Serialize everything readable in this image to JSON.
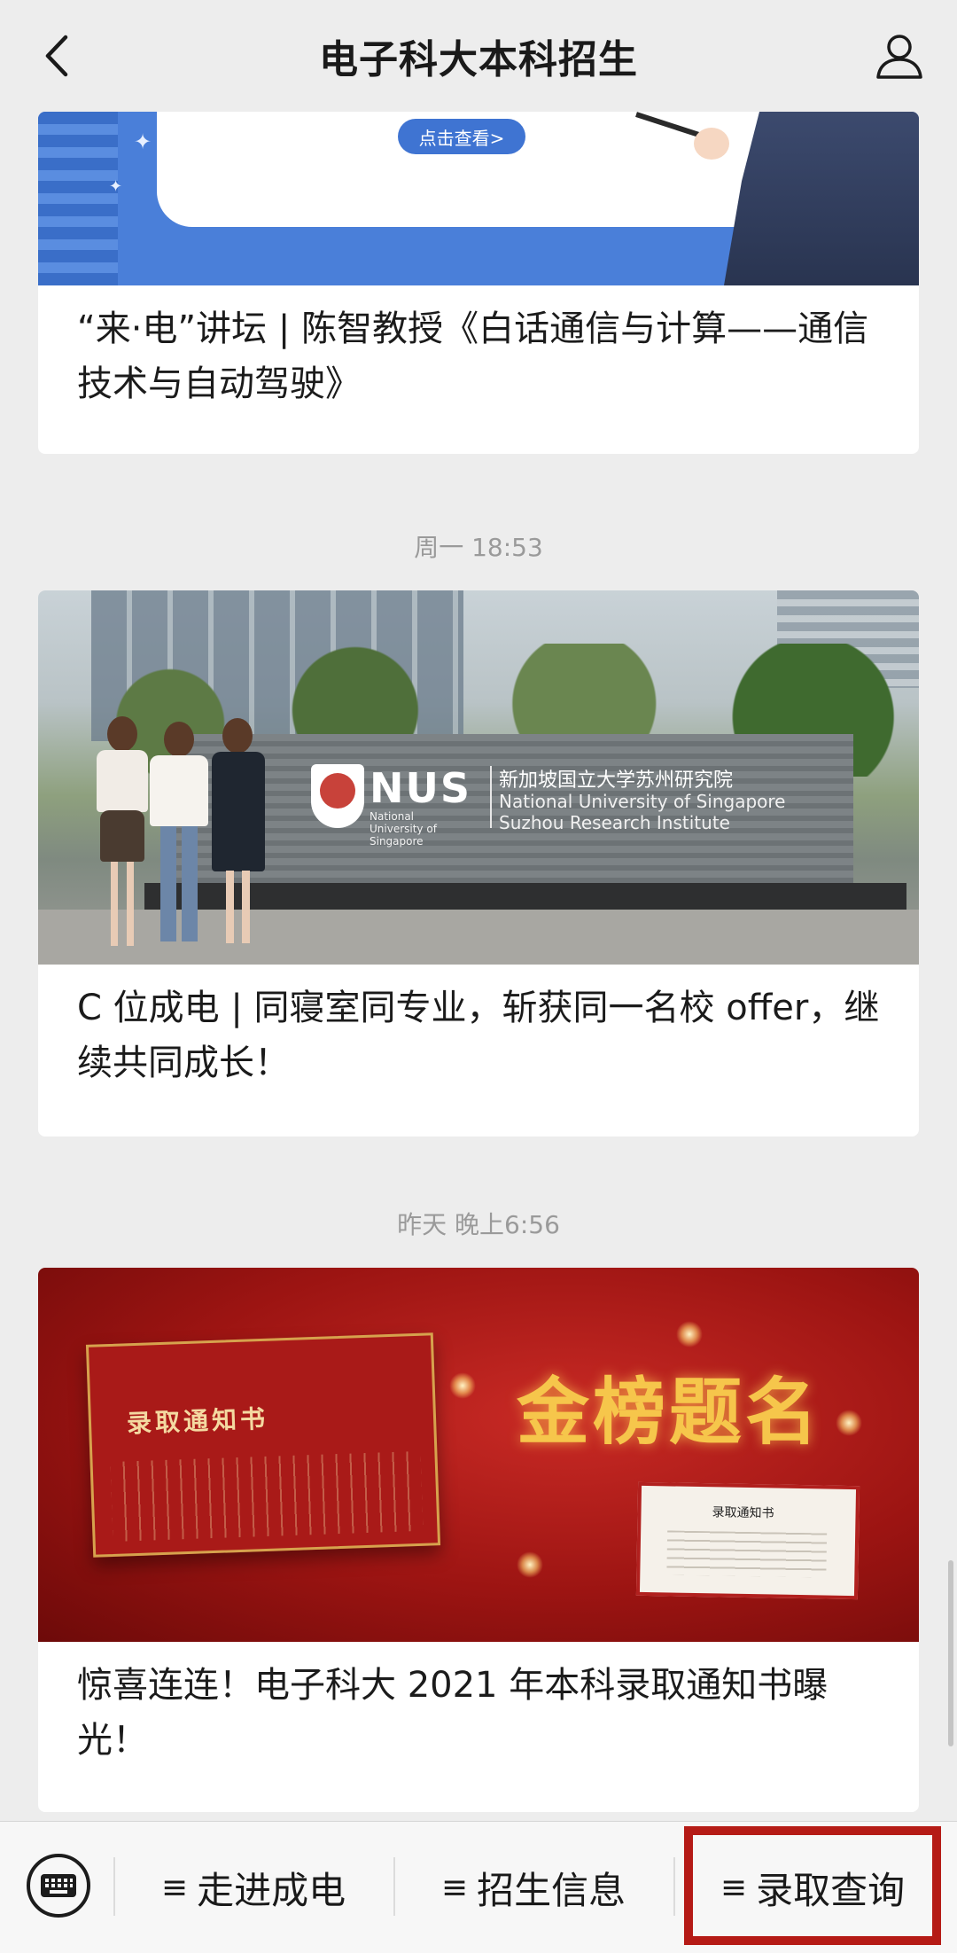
{
  "header": {
    "title": "电子科大本科招生",
    "back_icon": "chevron-left-icon",
    "profile_icon": "person-icon"
  },
  "feed": {
    "items": [
      {
        "time": "",
        "thumb_button": "点击查看>",
        "title": "“来·电”讲坛 | 陈智教授《白话通信与计算——通信技术与自动驾驶》"
      },
      {
        "time": "周一 18:53",
        "thumb_sign": {
          "brand": "NUS",
          "brand_sub": "National University of Singapore",
          "name_cn": "新加坡国立大学苏州研究院",
          "name_en_1": "National University of Singapore",
          "name_en_2": "Suzhou Research Institute"
        },
        "title": "C 位成电 | 同寝室同专业，斩获同一名校 offer，继续共同成长！"
      },
      {
        "time": "昨天 晚上6:56",
        "thumb_text": {
          "book_title": "录取通知书",
          "headline": "金榜题名",
          "letter_title": "录取通知书"
        },
        "title": "惊喜连连！电子科大 2021 年本科录取通知书曝光！"
      }
    ]
  },
  "bottom_bar": {
    "keyboard_icon": "keyboard-icon",
    "menus": [
      {
        "label": "走进成电"
      },
      {
        "label": "招生信息"
      },
      {
        "label": "录取查询"
      }
    ],
    "highlight_color": "#b51b16"
  }
}
